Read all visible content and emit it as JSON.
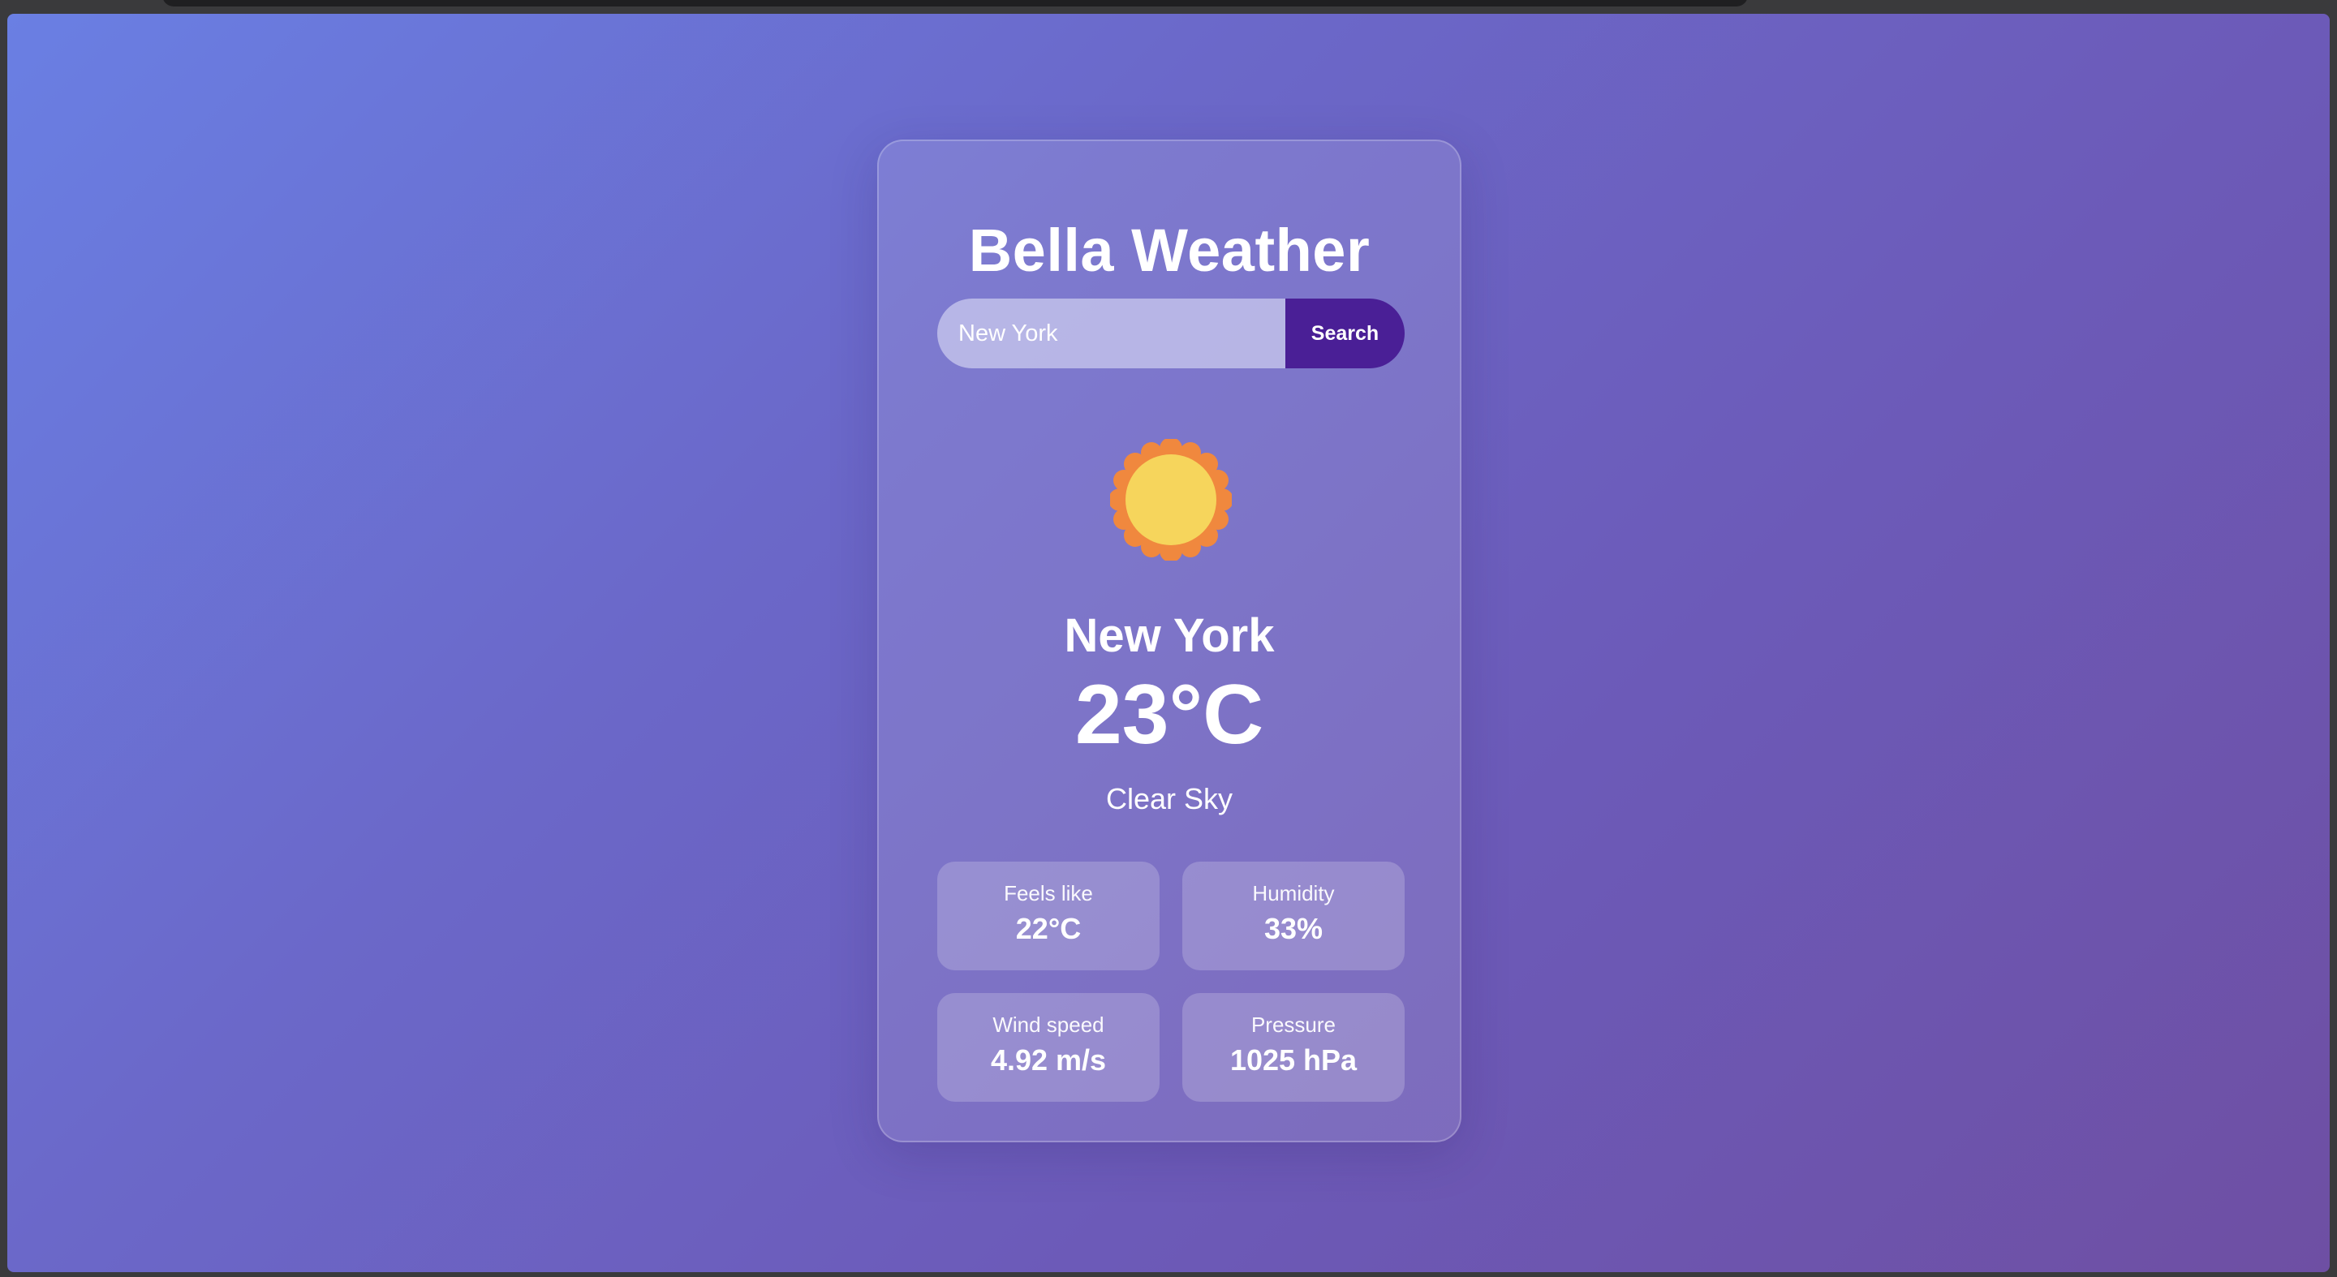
{
  "app": {
    "title": "Bella Weather"
  },
  "search": {
    "value": "New York",
    "button_label": "Search"
  },
  "weather": {
    "icon": "sun-icon",
    "city": "New York",
    "temperature": "23°C",
    "description": "Clear Sky"
  },
  "stats": [
    {
      "label": "Feels like",
      "value": "22°C"
    },
    {
      "label": "Humidity",
      "value": "33%"
    },
    {
      "label": "Wind speed",
      "value": "4.92 m/s"
    },
    {
      "label": "Pressure",
      "value": "1025 hPa"
    }
  ],
  "colors": {
    "background_start": "#6a7fe3",
    "background_end": "#6e4fa3",
    "accent": "#4a1f96",
    "sun_core": "#f6d55c",
    "sun_rays": "#f0883e"
  }
}
